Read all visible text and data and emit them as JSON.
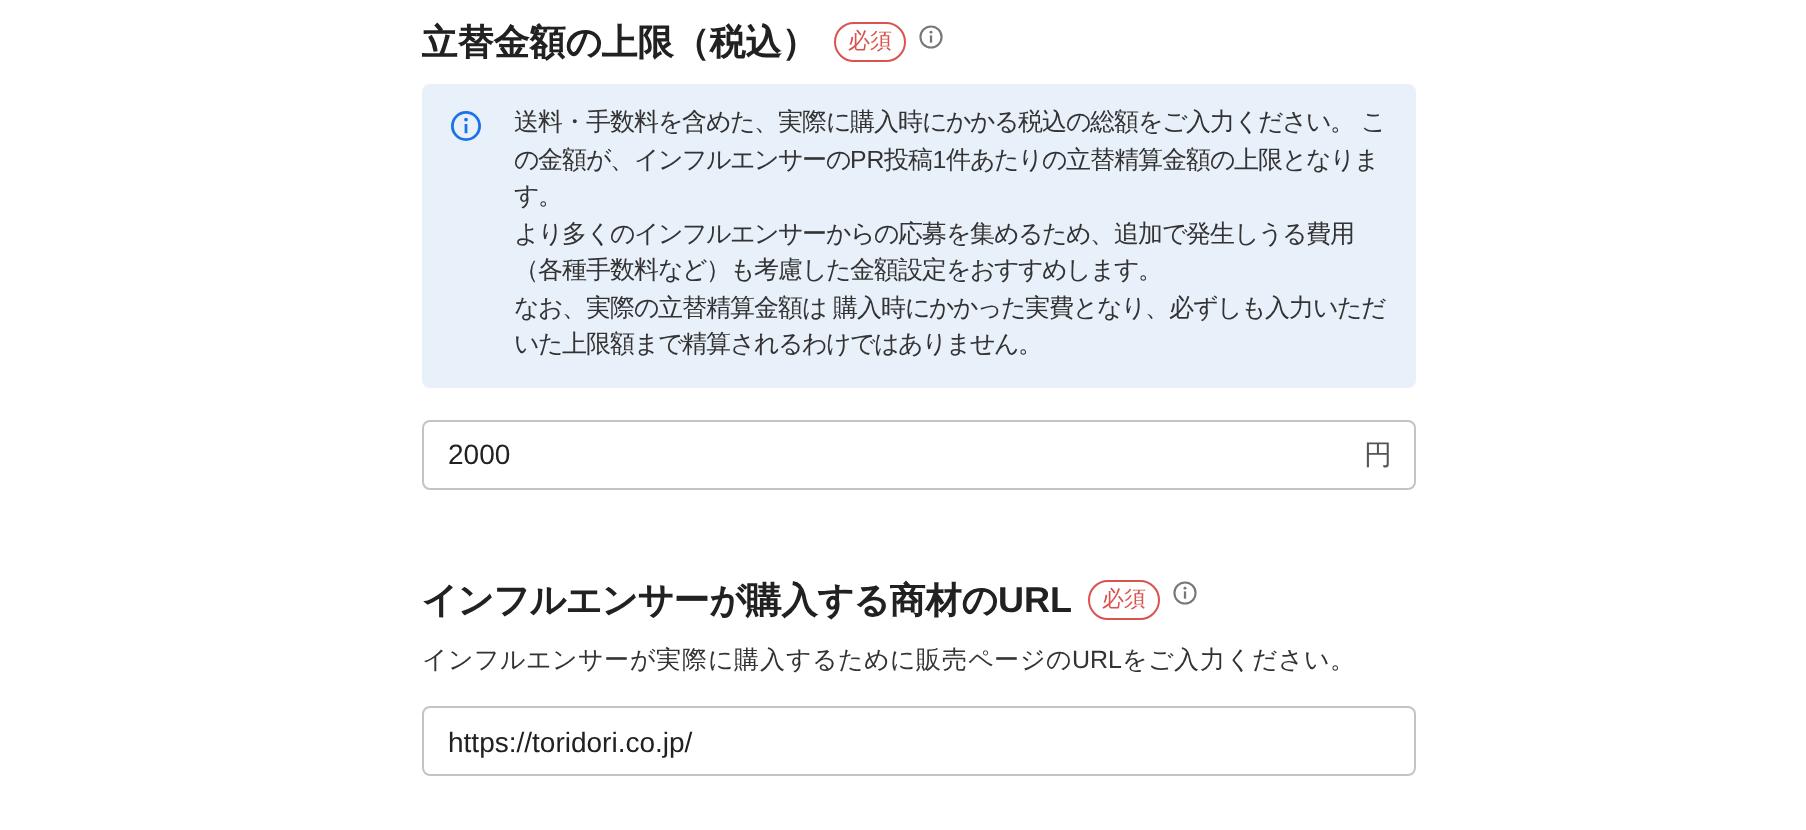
{
  "sections": [
    {
      "title": "立替金額の上限（税込）",
      "badge": "必須",
      "notice": [
        "送料・手数料を含めた、実際に購入時にかかる税込の総額をご入力ください。 この金額が、インフルエンサーのPR投稿1件あたりの立替精算金額の上限となります。",
        "より多くのインフルエンサーからの応募を集めるため、追加で発生しうる費用（各種手数料など）も考慮した金額設定をおすすめします。",
        "なお、実際の立替精算金額は 購入時にかかった実費となり、必ずしも入力いただいた上限額まで精算されるわけではありません。"
      ],
      "value": "2000",
      "unit": "円"
    },
    {
      "title": "インフルエンサーが購入する商材のURL",
      "badge": "必須",
      "description": "インフルエンサーが実際に購入するために販売ページのURLをご入力ください。",
      "value": "https://toridori.co.jp/"
    }
  ]
}
